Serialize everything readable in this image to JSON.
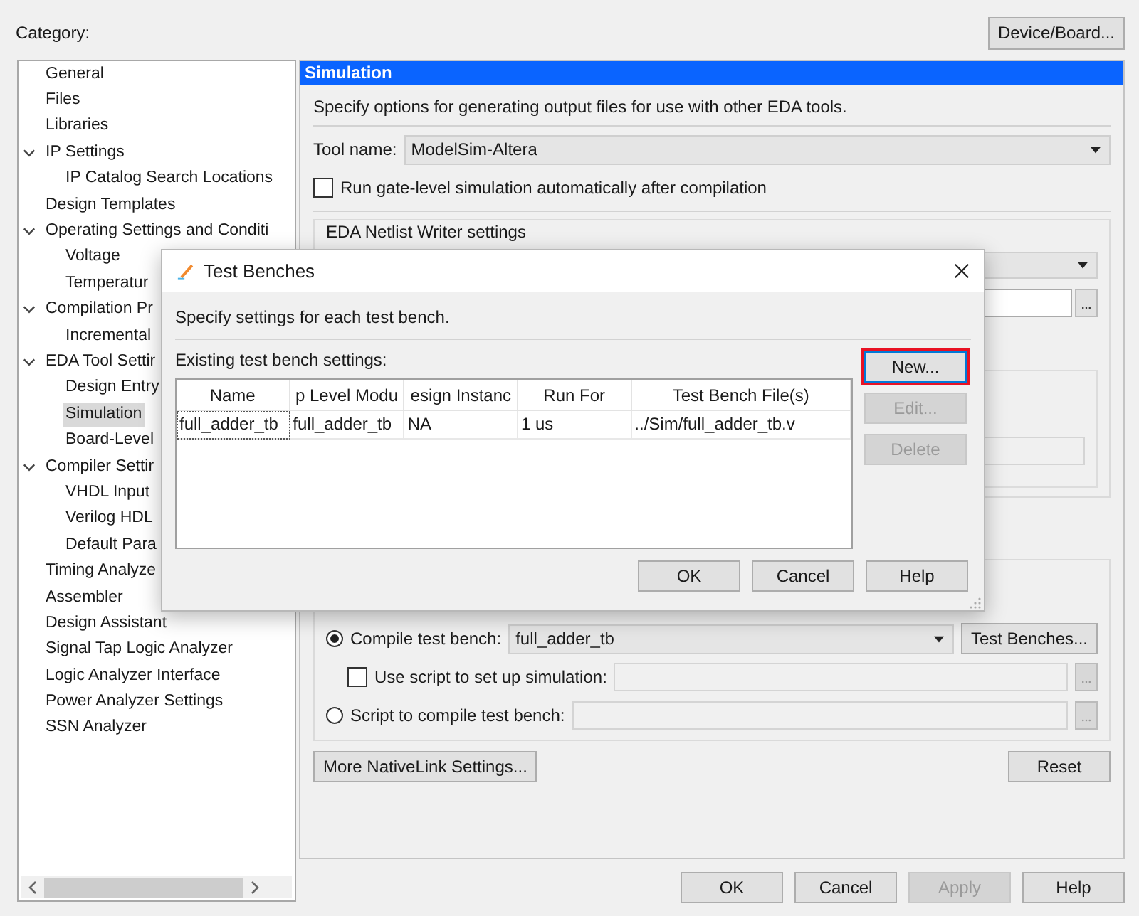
{
  "category_label": "Category:",
  "device_board_button": "Device/Board...",
  "tree": [
    {
      "label": "General",
      "selected": false
    },
    {
      "label": "Files",
      "selected": false
    },
    {
      "label": "Libraries",
      "selected": false
    },
    {
      "label": "IP Settings",
      "selected": false,
      "expanded": true,
      "children": [
        {
          "label": "IP Catalog Search Locations",
          "selected": false
        }
      ]
    },
    {
      "label": "Design Templates",
      "selected": false
    },
    {
      "label": "Operating Settings and Conditi",
      "selected": false,
      "expanded": true,
      "children": [
        {
          "label": "Voltage",
          "selected": false
        },
        {
          "label": "Temperatur",
          "selected": false
        }
      ]
    },
    {
      "label": "Compilation Pr",
      "selected": false,
      "expanded": true,
      "children": [
        {
          "label": "Incremental",
          "selected": false
        }
      ]
    },
    {
      "label": "EDA Tool Settir",
      "selected": false,
      "expanded": true,
      "children": [
        {
          "label": "Design Entry",
          "selected": false
        },
        {
          "label": "Simulation",
          "selected": true
        },
        {
          "label": "Board-Level",
          "selected": false
        }
      ]
    },
    {
      "label": "Compiler Settir",
      "selected": false,
      "expanded": true,
      "children": [
        {
          "label": "VHDL Input",
          "selected": false
        },
        {
          "label": "Verilog HDL",
          "selected": false
        },
        {
          "label": "Default Para",
          "selected": false
        }
      ]
    },
    {
      "label": "Timing Analyze",
      "selected": false
    },
    {
      "label": "Assembler",
      "selected": false
    },
    {
      "label": "Design Assistant",
      "selected": false
    },
    {
      "label": "Signal Tap Logic Analyzer",
      "selected": false
    },
    {
      "label": "Logic Analyzer Interface",
      "selected": false
    },
    {
      "label": "Power Analyzer Settings",
      "selected": false
    },
    {
      "label": "SSN Analyzer",
      "selected": false
    }
  ],
  "panel": {
    "title": "Simulation",
    "description": "Specify options for generating output files for use with other EDA tools.",
    "tool_name": {
      "label": "Tool name:",
      "value": "ModelSim-Altera"
    },
    "gate_level": {
      "label": "Run gate-level simulation automatically after compilation",
      "checked": false
    },
    "netlist_group": {
      "title": "EDA Netlist Writer settings"
    },
    "compile_test_bench": {
      "label": "Compile test bench:",
      "selected": true,
      "value": "full_adder_tb",
      "button": "Test Benches..."
    },
    "use_script": {
      "label": "Use script to set up simulation:",
      "checked": false
    },
    "script_compile": {
      "label": "Script to compile test bench:",
      "selected": false
    },
    "more_button": "More NativeLink Settings...",
    "reset_button": "Reset"
  },
  "footer_buttons": [
    {
      "label": "OK",
      "disabled": false
    },
    {
      "label": "Cancel",
      "disabled": false
    },
    {
      "label": "Apply",
      "disabled": true
    },
    {
      "label": "Help",
      "disabled": false
    }
  ],
  "dialog": {
    "title": "Test Benches",
    "description": "Specify settings for each test bench.",
    "table_label": "Existing test bench settings:",
    "columns": [
      "Name",
      "p Level Modu",
      "esign Instanc",
      "Run For",
      "Test Bench File(s)"
    ],
    "rows": [
      {
        "cells": [
          "full_adder_tb",
          "full_adder_tb",
          "NA",
          "1 us",
          "../Sim/full_adder_tb.v"
        ]
      }
    ],
    "side_buttons": [
      {
        "label": "New...",
        "disabled": false,
        "highlighted": true
      },
      {
        "label": "Edit...",
        "disabled": true,
        "highlighted": false
      },
      {
        "label": "Delete",
        "disabled": true,
        "highlighted": false
      }
    ],
    "buttons": [
      {
        "label": "OK",
        "disabled": false
      },
      {
        "label": "Cancel",
        "disabled": false
      },
      {
        "label": "Help",
        "disabled": false
      }
    ]
  }
}
